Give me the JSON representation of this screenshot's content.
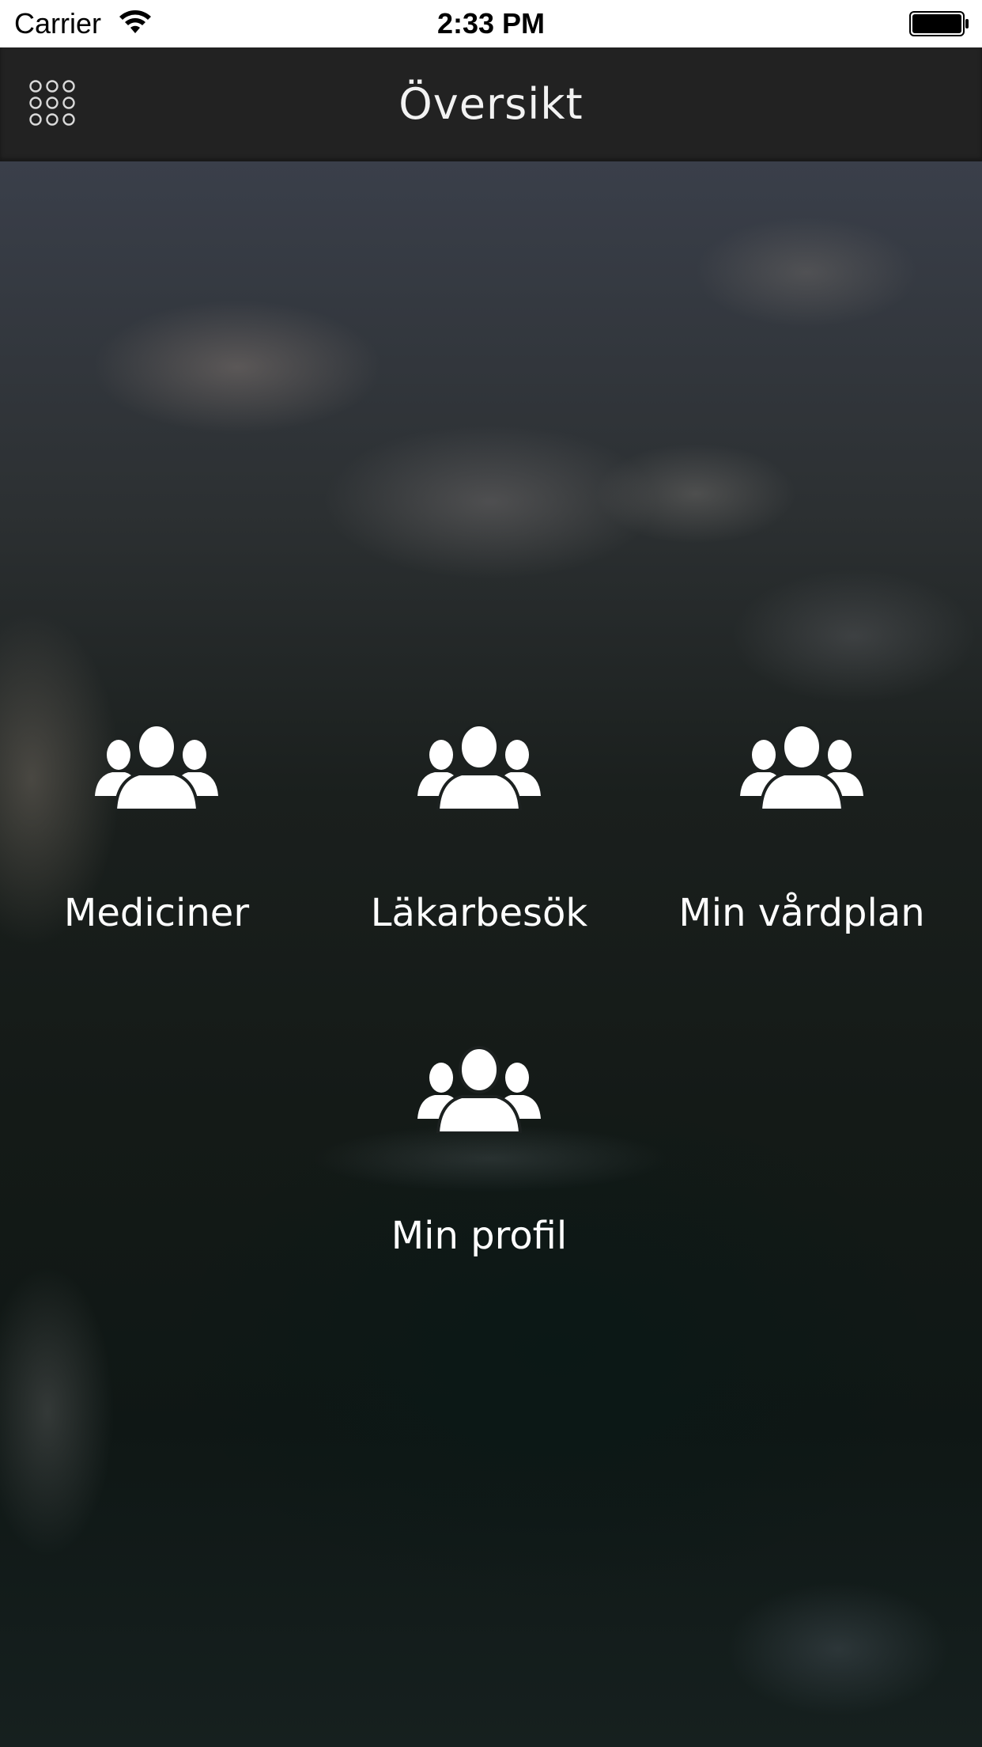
{
  "status_bar": {
    "carrier": "Carrier",
    "time": "2:33 PM",
    "wifi_icon": "wifi-icon",
    "battery_icon": "battery-icon"
  },
  "nav": {
    "title": "Översikt",
    "menu_icon": "grid-menu-icon"
  },
  "tiles": [
    {
      "label": "Mediciner",
      "icon": "people-group-icon"
    },
    {
      "label": "Läkarbesök",
      "icon": "people-group-icon"
    },
    {
      "label": "Min vårdplan",
      "icon": "people-group-icon"
    },
    {
      "label": "Min profil",
      "icon": "people-group-icon"
    }
  ],
  "colors": {
    "nav_background": "#222222",
    "status_background": "#ffffff",
    "label_text": "#ffffff",
    "icon_fill": "#ffffff"
  }
}
